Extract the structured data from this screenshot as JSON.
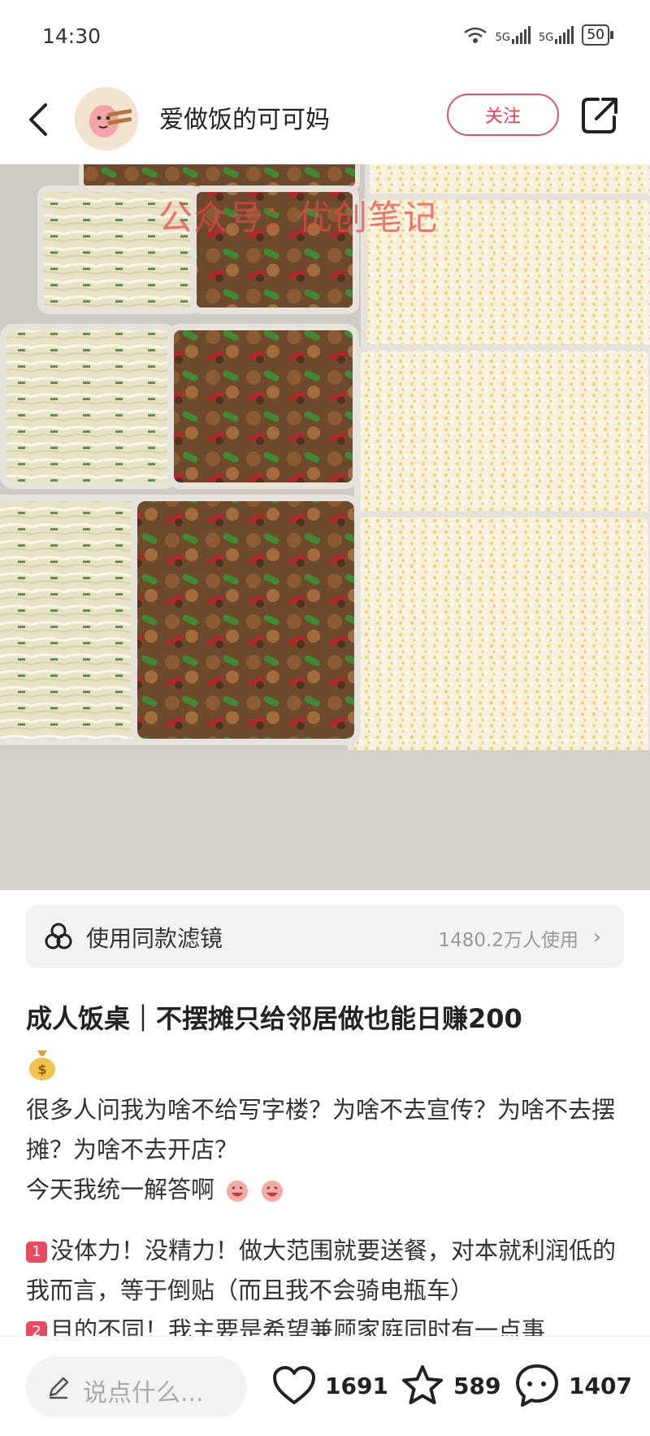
{
  "status_bar": {
    "time": "14:30",
    "network_1": "5G",
    "network_2": "5G",
    "battery": "50"
  },
  "header": {
    "username": "爱做饭的可可妈",
    "follow_label": "关注"
  },
  "photo": {
    "watermark": "公众号：优创笔记"
  },
  "filter": {
    "label": "使用同款滤镜",
    "usage_count": "1480.2万人使用"
  },
  "post": {
    "title": "成人饭桌｜不摆摊只给邻居做也能日赚200",
    "intro_line_1": "很多人问我为啥不给写字楼？为啥不去宣传？为啥不去摆摊？为啥不去开店？",
    "intro_line_2": "今天我统一解答啊",
    "point_1_number": "1",
    "point_1_text": "没体力！没精力！做大范围就要送餐，对本就利润低的我而言，等于倒贴（而且我不会骑电瓶车）",
    "point_2_number": "2",
    "point_2_text": "目的不同！我主要是希望兼顾家庭同时有一点事"
  },
  "bottom_bar": {
    "comment_placeholder": "说点什么...",
    "likes": "1691",
    "favorites": "589",
    "comments": "1407"
  },
  "colors": {
    "accent_red": "#e0424f",
    "badge_red": "#e84a5f"
  }
}
